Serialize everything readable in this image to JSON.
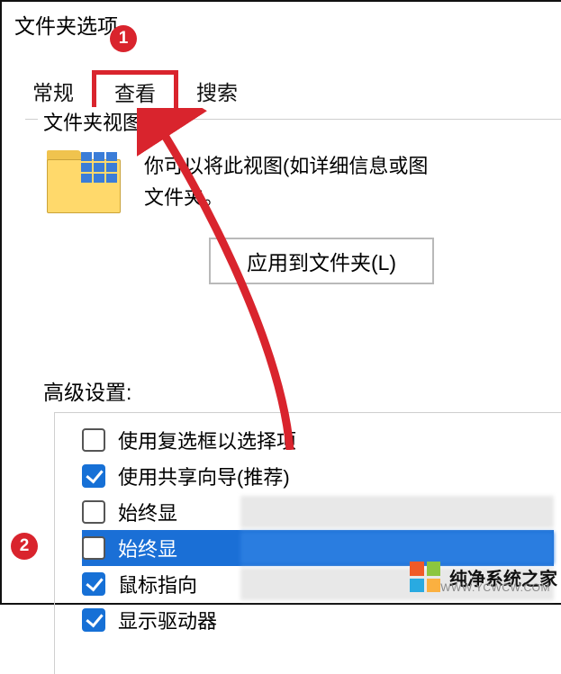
{
  "window": {
    "title": "文件夹选项"
  },
  "markers": {
    "one": "1",
    "two": "2"
  },
  "tabs": {
    "general": "常规",
    "view": "查看",
    "search": "搜索"
  },
  "folderView": {
    "groupLabel": "文件夹视图",
    "descLine1": "你可以将此视图(如详细信息或图",
    "descLine2": "文件夹。",
    "applyButton": "应用到文件夹(L)"
  },
  "advanced": {
    "label": "高级设置:",
    "items": [
      {
        "label": "使用复选框以选择项",
        "checked": false,
        "selected": false
      },
      {
        "label": "使用共享向导(推荐)",
        "checked": true,
        "selected": false
      },
      {
        "label": "始终显",
        "checked": false,
        "selected": false,
        "obscured": true
      },
      {
        "label": "始终显",
        "checked": false,
        "selected": true,
        "obscured": true
      },
      {
        "label": "鼠标指向",
        "checked": true,
        "selected": false,
        "obscured": true
      },
      {
        "label": "显示驱动器",
        "checked": true,
        "selected": false,
        "obscured": true
      }
    ]
  },
  "watermark": {
    "brand": "纯净系统之家",
    "url": "WWW.YCWCW.COM"
  }
}
